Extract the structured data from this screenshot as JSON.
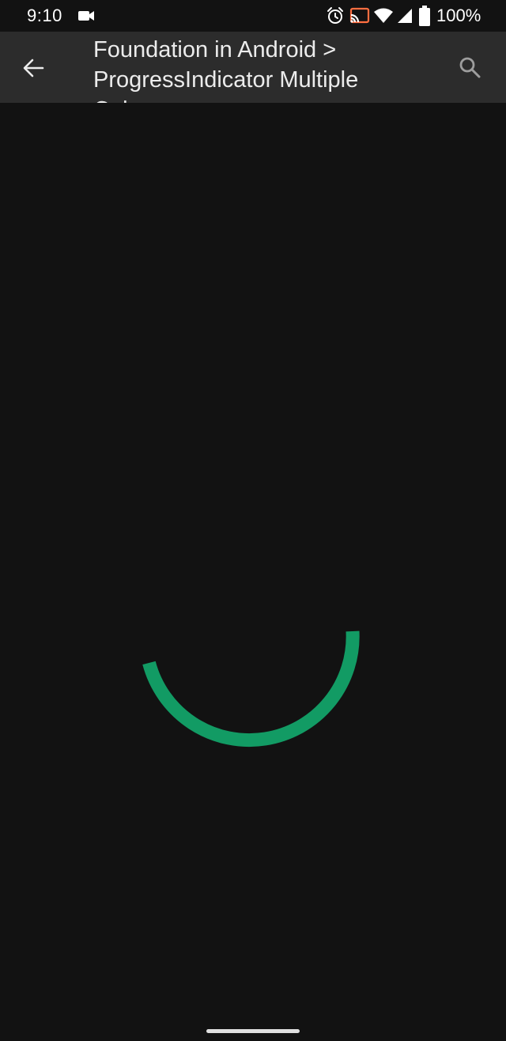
{
  "status_bar": {
    "time": "9:10",
    "battery_percent": "100%",
    "icons": [
      "video-camera-icon",
      "alarm-icon",
      "cast-icon",
      "wifi-icon",
      "signal-icon",
      "battery-icon"
    ]
  },
  "app_bar": {
    "title": "Foundation in Android > ProgressIndicator Multiple Colors",
    "back_icon": "arrow-back-icon",
    "search_icon": "search-icon"
  },
  "progress_indicator": {
    "type": "circular-indeterminate",
    "color": "#129b64"
  },
  "colors": {
    "background": "#121212",
    "app_bar": "#2c2c2c",
    "progress": "#129b64"
  }
}
